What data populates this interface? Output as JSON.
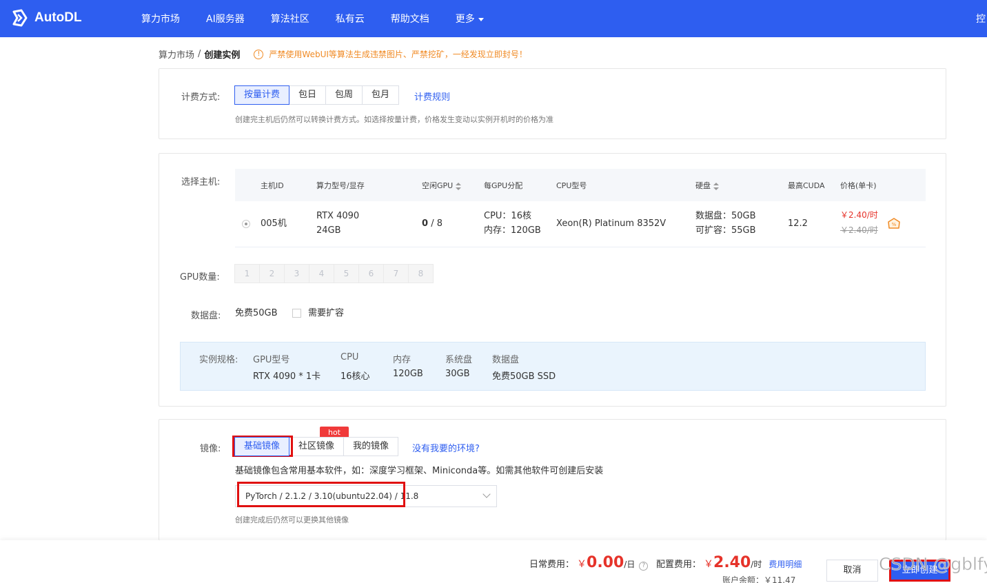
{
  "app": {
    "name": "AutoDL"
  },
  "nav": {
    "items": [
      "算力市场",
      "AI服务器",
      "算法社区",
      "私有云",
      "帮助文档",
      "更多"
    ],
    "right": "控"
  },
  "breadcrumb": {
    "parent": "算力市场",
    "sep": "/",
    "current": "创建实例"
  },
  "warning": "严禁使用WebUI等算法生成违禁图片、严禁挖矿，一经发现立即封号！",
  "billing": {
    "label": "计费方式:",
    "options": [
      "按量计费",
      "包日",
      "包周",
      "包月"
    ],
    "selected": "按量计费",
    "rules_link": "计费规则",
    "hint": "创建完主机后仍然可以转换计费方式。如选择按量计费，价格发生变动以实例开机时的价格为准"
  },
  "host": {
    "label": "选择主机:",
    "columns": [
      "主机ID",
      "算力型号/显存",
      "空闲GPU",
      "每GPU分配",
      "CPU型号",
      "硬盘",
      "最高CUDA",
      "价格(单卡)"
    ],
    "row": {
      "id": "005机",
      "gpu_model": "RTX 4090",
      "gpu_mem": "24GB",
      "free_gpu": "0",
      "total_gpu": "/ 8",
      "cpu_alloc": "CPU：16核",
      "mem_alloc": "内存：120GB",
      "cpu_model": "Xeon(R) Platinum 8352V",
      "disk_data": "数据盘：50GB",
      "disk_expand": "可扩容：55GB",
      "cuda": "12.2",
      "price": "￥2.40/时",
      "price_old": "￥2.40/时",
      "badge_icon": "discount-badge-icon"
    }
  },
  "gpu_count": {
    "label": "GPU数量:",
    "options": [
      "1",
      "2",
      "3",
      "4",
      "5",
      "6",
      "7",
      "8"
    ]
  },
  "data_disk": {
    "label": "数据盘:",
    "free": "免费50GB",
    "expand_label": "需要扩容"
  },
  "spec": {
    "label": "实例规格:",
    "columns": [
      {
        "h": "GPU型号",
        "v": "RTX 4090 * 1卡"
      },
      {
        "h": "CPU",
        "v": "16核心"
      },
      {
        "h": "内存",
        "v": "120GB"
      },
      {
        "h": "系统盘",
        "v": "30GB"
      },
      {
        "h": "数据盘",
        "v": "免费50GB SSD"
      }
    ]
  },
  "image": {
    "label": "镜像:",
    "tabs": [
      "基础镜像",
      "社区镜像",
      "我的镜像"
    ],
    "selected": "基础镜像",
    "hot_badge": "hot",
    "missing_link": "没有我要的环境?",
    "desc": "基础镜像包含常用基本软件，如：深度学习框架、Miniconda等。如需其他软件可创建后安装",
    "selected_value": "PyTorch / 2.1.2 / 3.10(ubuntu22.04) / 11.8",
    "hint": "创建完成后仍然可以更换其他镜像"
  },
  "footer": {
    "daily_label": "日常费用：",
    "daily_currency": "￥",
    "daily_amount": "0.00",
    "daily_unit": "/日",
    "config_label": "配置费用：",
    "config_currency": "￥",
    "config_amount": "2.40",
    "config_unit": "/时",
    "detail_link": "费用明细",
    "balance": "账户余额：￥11.47",
    "cancel": "取消",
    "create": "立即创建",
    "watermark": "CSDN @gblfy"
  },
  "colors": {
    "primary": "#2e5ef0",
    "danger": "#e6332a",
    "warning": "#f08a24",
    "annotation": "#e01010"
  }
}
